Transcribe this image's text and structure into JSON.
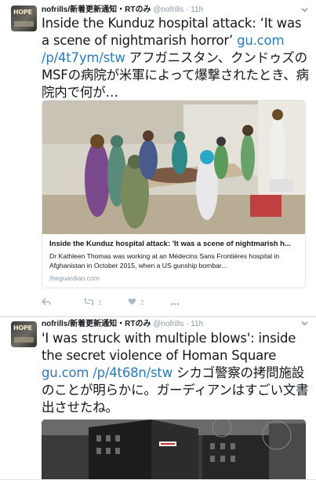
{
  "tweets": [
    {
      "author_name": "nofrills/新着更新通知・RTのみ",
      "handle": "@nofrills",
      "separator": "·",
      "time": "11h",
      "avatar_label": "HOPE",
      "text_prefix": "Inside the Kunduz hospital attack: ‘It was a scene of nightmarish horror’ ",
      "link": "gu.com /p/4t7ym/stw",
      "text_suffix": " アフガニスタン、クンドゥズのMSFの病院が米軍によって爆撃されたとき、病院内で何が…",
      "card": {
        "title": "Inside the Kunduz hospital attack: 'It was a scene of nightmarish h...",
        "description": "Dr Kathleen Thomas was working at an Médecins Sans Frontières hospital in Afghanistan in October 2015, when a US gunship bombar...",
        "domain": "theguardian.com"
      },
      "actions": {
        "reply_icon": "reply-icon",
        "retweet_count": "2",
        "like_count": "2"
      }
    },
    {
      "author_name": "nofrills/新着更新通知・RTのみ",
      "handle": "@nofrills",
      "separator": "·",
      "time": "11h",
      "avatar_label": "HOPE",
      "text_prefix": "'I was struck with multiple blows': inside the secret violence of Homan Square ",
      "link": "gu.com /p/4t68n/stw",
      "text_suffix": " シカゴ警察の拷問施設のことが明らかに。ガーディアンはすごい文書出させたね。"
    }
  ],
  "colors": {
    "link": "#2b7bb9",
    "muted": "#8899a6",
    "border": "#e1e8ed",
    "background": "#e9eef2"
  }
}
